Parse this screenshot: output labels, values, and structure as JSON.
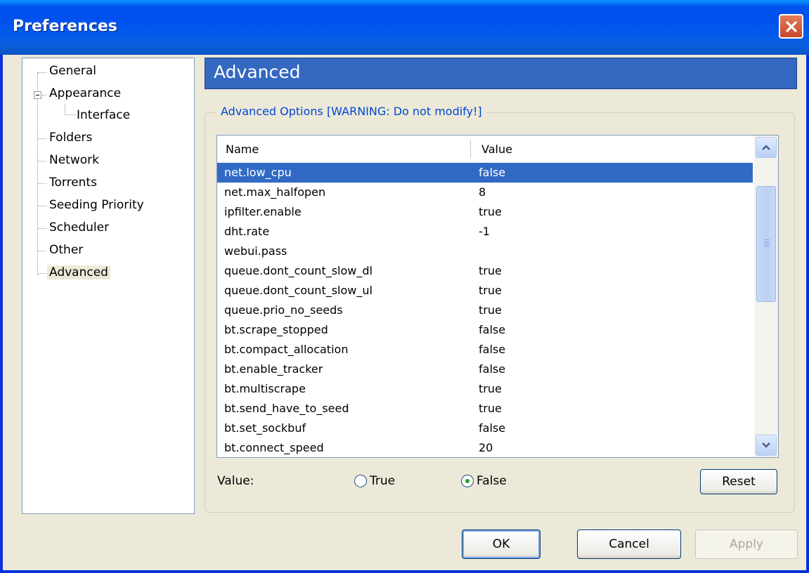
{
  "window": {
    "title": "Preferences"
  },
  "tree": {
    "items": [
      {
        "label": "General"
      },
      {
        "label": "Appearance"
      },
      {
        "label": "Interface"
      },
      {
        "label": "Folders"
      },
      {
        "label": "Network"
      },
      {
        "label": "Torrents"
      },
      {
        "label": "Seeding Priority"
      },
      {
        "label": "Scheduler"
      },
      {
        "label": "Other"
      },
      {
        "label": "Advanced"
      }
    ],
    "selected": "Advanced"
  },
  "header": {
    "title": "Advanced"
  },
  "group": {
    "title": "Advanced Options [WARNING: Do not modify!]"
  },
  "list": {
    "columns": {
      "name": "Name",
      "value": "Value"
    },
    "rows": [
      {
        "name": "net.low_cpu",
        "value": "false"
      },
      {
        "name": "net.max_halfopen",
        "value": "8"
      },
      {
        "name": "ipfilter.enable",
        "value": "true"
      },
      {
        "name": "dht.rate",
        "value": "-1"
      },
      {
        "name": "webui.pass",
        "value": ""
      },
      {
        "name": "queue.dont_count_slow_dl",
        "value": "true"
      },
      {
        "name": "queue.dont_count_slow_ul",
        "value": "true"
      },
      {
        "name": "queue.prio_no_seeds",
        "value": "true"
      },
      {
        "name": "bt.scrape_stopped",
        "value": "false"
      },
      {
        "name": "bt.compact_allocation",
        "value": "false"
      },
      {
        "name": "bt.enable_tracker",
        "value": "false"
      },
      {
        "name": "bt.multiscrape",
        "value": "true"
      },
      {
        "name": "bt.send_have_to_seed",
        "value": "true"
      },
      {
        "name": "bt.set_sockbuf",
        "value": "false"
      },
      {
        "name": "bt.connect_speed",
        "value": "20"
      }
    ],
    "selected_row": "net.low_cpu"
  },
  "value_editor": {
    "label": "Value:",
    "true_label": "True",
    "false_label": "False",
    "selected": "False",
    "reset_label": "Reset"
  },
  "footer": {
    "ok_label": "OK",
    "cancel_label": "Cancel",
    "apply_label": "Apply"
  }
}
